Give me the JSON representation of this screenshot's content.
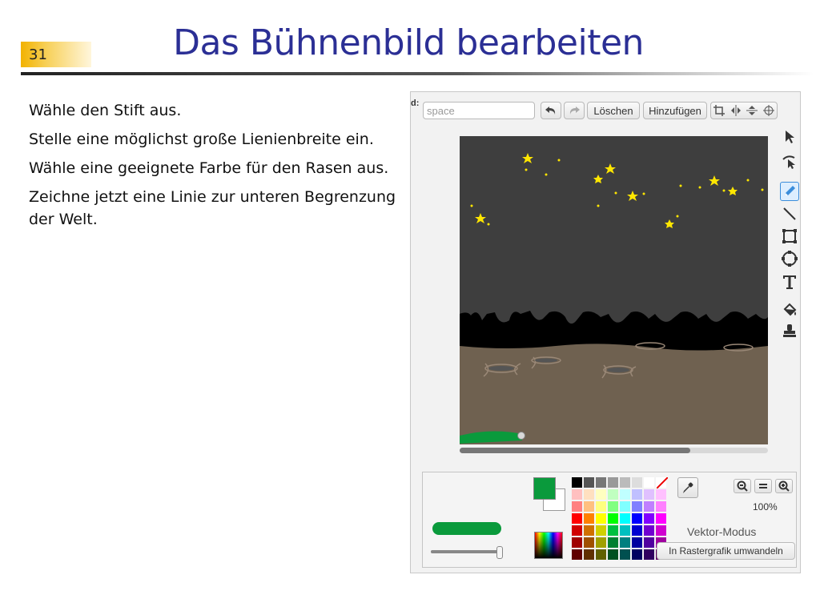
{
  "slide": {
    "number": "31",
    "title": "Das Bühnenbild bearbeiten",
    "bullets": [
      "Wähle den Stift aus.",
      "Stelle eine möglichst große Lienienbreite ein.",
      "Wähle eine geeignete Farbe für den Rasen aus.",
      "Zeichne jetzt eine Linie zur unteren Begrenzung der Welt."
    ]
  },
  "editor": {
    "label_fragment": "d:",
    "name_field": "space",
    "toolbar": {
      "undo_icon": "undo-icon",
      "redo_icon": "redo-icon",
      "clear_label": "Löschen",
      "add_label": "Hinzufügen"
    },
    "tools": [
      "select-arrow-icon",
      "reshape-icon",
      "pencil-icon",
      "line-icon",
      "rectangle-icon",
      "ellipse-icon",
      "text-icon",
      "fill-bucket-icon",
      "stamp-icon"
    ],
    "selected_tool": "pencil-icon",
    "zoom_percent": "100%",
    "mode": "Vektor-Modus",
    "convert_button": "In Rastergrafik umwandeln",
    "primary_color": "#0a9a3c",
    "secondary_color": "#ffffff",
    "brush_size_fraction": 1.0,
    "palette": [
      [
        "#000000",
        "#555555",
        "#777777",
        "#999999",
        "#bbbbbb",
        "#dddddd",
        "#ffffff",
        "#ffffff"
      ],
      [
        "#ffc0c0",
        "#ffe0c0",
        "#ffffc0",
        "#c0ffc0",
        "#c0ffff",
        "#c0c0ff",
        "#e0c0ff",
        "#ffc0ff"
      ],
      [
        "#ff8080",
        "#ffc080",
        "#ffff80",
        "#80ff80",
        "#80ffff",
        "#8080ff",
        "#c080ff",
        "#ff80ff"
      ],
      [
        "#ff0000",
        "#ff8000",
        "#ffff00",
        "#00ff00",
        "#00ffff",
        "#0000ff",
        "#8000ff",
        "#ff00ff"
      ],
      [
        "#d00000",
        "#d07000",
        "#d0d000",
        "#00c040",
        "#00c0c0",
        "#0000d0",
        "#7000d0",
        "#d000d0"
      ],
      [
        "#a00000",
        "#a05000",
        "#a0a000",
        "#008030",
        "#008080",
        "#0000a0",
        "#5000a0",
        "#a000a0"
      ],
      [
        "#600000",
        "#603000",
        "#606000",
        "#005020",
        "#005050",
        "#000060",
        "#300060",
        "#600060"
      ]
    ]
  }
}
